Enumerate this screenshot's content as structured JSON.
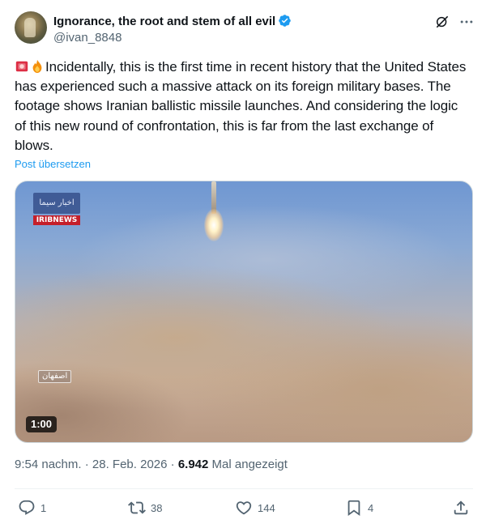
{
  "tweet": {
    "author_name": "Ignorance, the root and stem of all evil",
    "author_handle": "@ivan_8848",
    "text": "Incidentally, this is the first time in recent history that the United States has experienced such a massive attack on its foreign military bases. The footage shows Iranian ballistic missile launches. And considering the logic of this new round of confrontation, this is far from the last exchange of blows.",
    "emojis": [
      "police-light-emoji",
      "fire-emoji"
    ],
    "translate_label": "Post übersetzen",
    "time": "9:54 nachm.",
    "separator": "·",
    "date": "28. Feb. 2026",
    "views_count": "6.942",
    "views_label": "Mal angezeigt"
  },
  "media": {
    "duration": "1:00",
    "watermark_top": "اخبار سیما",
    "watermark_bottom": "IRIBNEWS",
    "location_label": "اصفهان"
  },
  "actions": {
    "reply_count": "1",
    "repost_count": "38",
    "like_count": "144",
    "bookmark_count": "4"
  },
  "colors": {
    "link": "#1d9bf0",
    "muted": "#536471",
    "text": "#0f1419"
  }
}
